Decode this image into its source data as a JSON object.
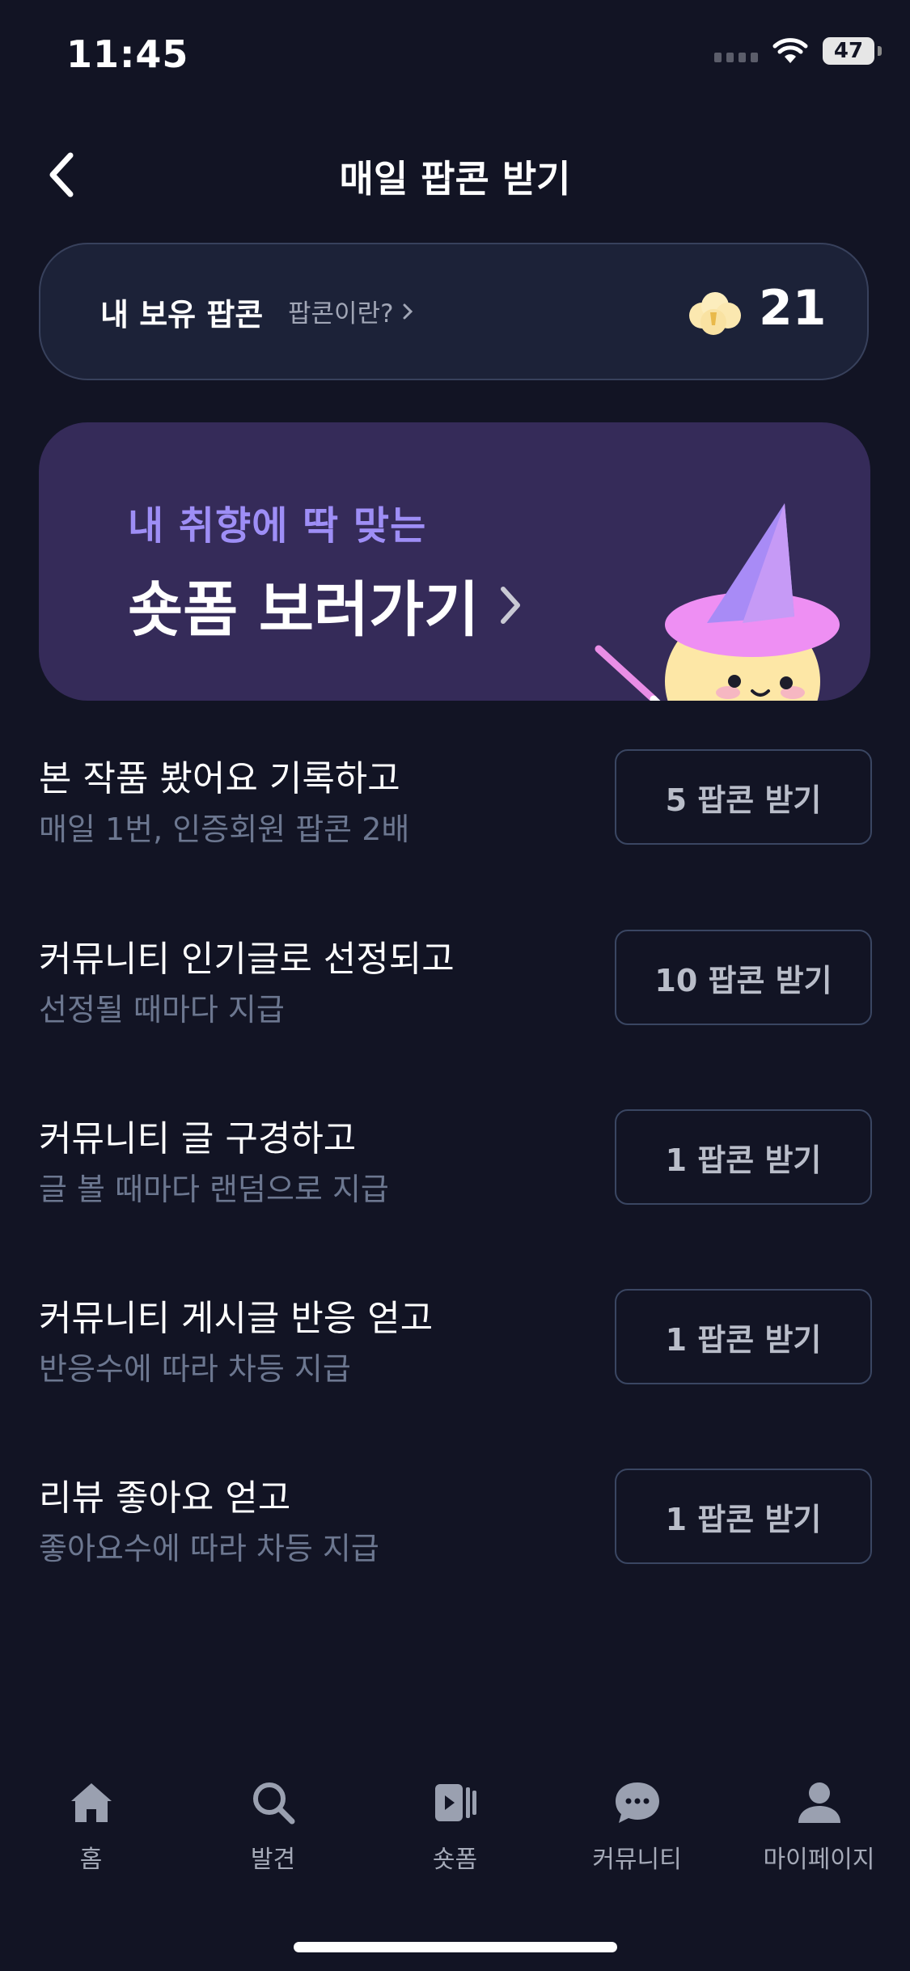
{
  "status_bar": {
    "time": "11:45",
    "battery": "47"
  },
  "header": {
    "title": "매일 팝콘 받기"
  },
  "popcorn_summary": {
    "label": "내 보유 팝콘",
    "link_text": "팝콘이란?",
    "count": "21"
  },
  "banner": {
    "subtitle": "내 취향에 딱 맞는",
    "title": "숏폼 보러가기"
  },
  "tasks": [
    {
      "title": "본 작품 봤어요 기록하고",
      "subtitle": "매일 1번, 인증회원 팝콘 2배",
      "button": "5 팝콘 받기"
    },
    {
      "title": "커뮤니티 인기글로 선정되고",
      "subtitle": "선정될 때마다 지급",
      "button": "10 팝콘 받기"
    },
    {
      "title": "커뮤니티 글 구경하고",
      "subtitle": "글 볼 때마다 랜덤으로 지급",
      "button": "1 팝콘 받기"
    },
    {
      "title": "커뮤니티 게시글 반응 얻고",
      "subtitle": "반응수에 따라 차등 지급",
      "button": "1 팝콘 받기"
    },
    {
      "title": "리뷰 좋아요 얻고",
      "subtitle": "좋아요수에 따라 차등 지급",
      "button": "1 팝콘 받기"
    }
  ],
  "tabbar": {
    "items": [
      {
        "label": "홈",
        "icon": "home-icon"
      },
      {
        "label": "발견",
        "icon": "search-icon"
      },
      {
        "label": "숏폼",
        "icon": "shortform-icon"
      },
      {
        "label": "커뮤니티",
        "icon": "chat-bubble-icon"
      },
      {
        "label": "마이페이지",
        "icon": "person-icon"
      }
    ]
  },
  "colors": {
    "background": "#121424",
    "card": "#1c2238",
    "banner": "#352b59",
    "accent_purple": "#9e8ef6",
    "muted_text": "#6c7790"
  }
}
